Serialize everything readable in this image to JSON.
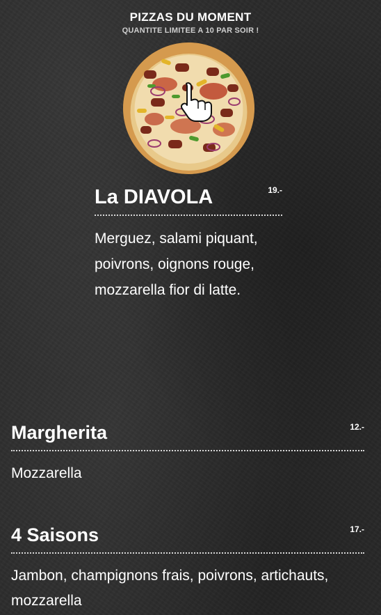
{
  "special": {
    "title": "PIZZAS DU MOMENT",
    "subtitle": "QUANTITE LIMITEE A 10 PAR SOIR !",
    "image_icon": "pizza-photo",
    "hand_icon": "pointing-hand-cursor",
    "item": {
      "name": "La DIAVOLA",
      "price": "19.-",
      "description": "Merguez, salami piquant, poivrons, oignons rouge, mozzarella fior di latte."
    }
  },
  "menu": {
    "items": [
      {
        "name": "Margherita",
        "price": "12.-",
        "description": "Mozzarella"
      },
      {
        "name": "4 Saisons",
        "price": "17.-",
        "description": "Jambon, champignons frais, poivrons, artichauts, mozzarella"
      }
    ]
  },
  "colors": {
    "background": "#2b2b2b",
    "text": "#ffffff",
    "subtitle": "#cfcfcf",
    "divider": "#d8d8d8"
  }
}
